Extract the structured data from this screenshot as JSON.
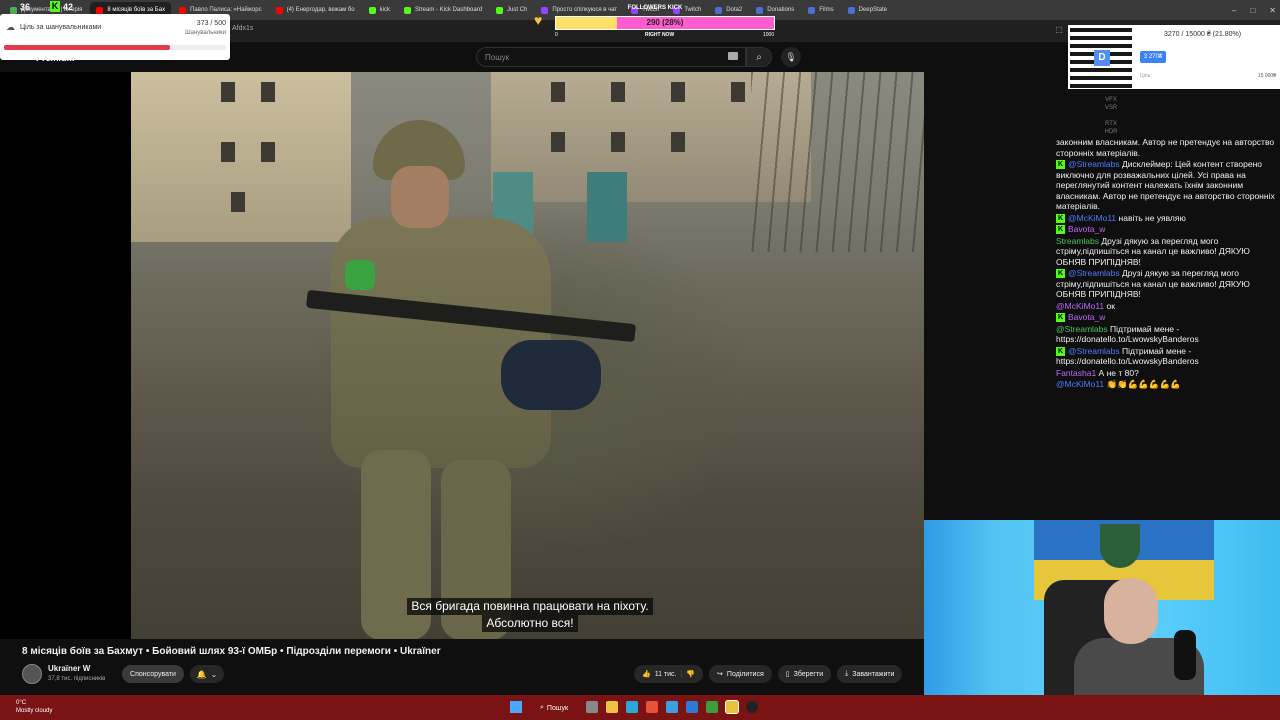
{
  "browser": {
    "tabs": [
      {
        "label": "Документація | Історія",
        "color": "#4caf50"
      },
      {
        "label": "8 місяців боїв за Бах",
        "color": "#ff0000",
        "active": true
      },
      {
        "label": "Павло Палиса: «Найжорс",
        "color": "#ff0000"
      },
      {
        "label": "(4) Енергодар, вежам бо",
        "color": "#ff0000"
      },
      {
        "label": "kick",
        "color": "#53fc18"
      },
      {
        "label": "Stream - Kick Dashboard",
        "color": "#53fc18"
      },
      {
        "label": "Just Ch",
        "color": "#53fc18"
      },
      {
        "label": "Просто спілкуюся в чат",
        "color": "#9146ff"
      },
      {
        "label": "Twitch",
        "color": "#9146ff"
      },
      {
        "label": "Twitch",
        "color": "#9146ff"
      },
      {
        "label": "Dota2",
        "color": "#4a6fd1"
      },
      {
        "label": "Donations",
        "color": "#4a6fd1"
      },
      {
        "label": "Films",
        "color": "#4a6fd1"
      },
      {
        "label": "DeepState",
        "color": "#4a6fd1"
      }
    ],
    "window_controls": [
      "–",
      "□",
      "✕"
    ],
    "url_fragment": "Afdx1s"
  },
  "youtube": {
    "premium_label": "Premium",
    "search_placeholder": "Пошук",
    "video_title": "8 місяців боїв за Бахмут • Бойовий шлях 93-ї ОМБр • Підрозділи перемоги • Ukraїner",
    "channel_name": "Ukraїner W",
    "channel_subs": "37,8 тис. підписників",
    "sponsor_label": "Спонсорувати",
    "likes": "11 тис.",
    "share_label": "Поділитися",
    "save_label": "Зберегти",
    "download_label": "Завантажити",
    "subtitle_line1": "Вся бригада повинна працювати на піхоту.",
    "subtitle_line2": "Абсолютно вся!",
    "player_menu": [
      "VFX",
      "VSR",
      "RTX",
      "HDR"
    ]
  },
  "overlay_goal": {
    "stream_num": "36",
    "kick_num": "42",
    "title": "Ціль за шанувальниками",
    "count": "373 / 500",
    "sub": "Шанувальники",
    "progress": 0.746
  },
  "overlay_followers": {
    "title": "FOLLOWERS KICK",
    "value_text": "290 (28%)",
    "progress": 0.28,
    "min": "0",
    "now_label": "RIGHT NOW",
    "max": "1000"
  },
  "overlay_donate": {
    "progress_text": "3270 / 15000 ₴ (21.80%)",
    "badge": "3 270₴",
    "label": "Ціль:",
    "max": "15 000₴"
  },
  "chat": {
    "messages": [
      {
        "user": "",
        "text": "законним власникам. Автор не претендує на авторство сторонніх матеріалів.",
        "platform": ""
      },
      {
        "user": "@Streamlabs",
        "text": "Дисклеймер: Цей контент створено виключно для розважальних цілей. Усі права на переглянутий контент належать їхнім законним власникам. Автор не претендує на авторство сторонніх матеріалів.",
        "platform": "K",
        "ucls": "blue"
      },
      {
        "user": "@McKiMo11",
        "text": "навіть не уявляю",
        "platform": "K",
        "ucls": "blue"
      },
      {
        "user": "Bavota_w",
        "text": "",
        "platform": "K",
        "ucls": "pink"
      },
      {
        "user": "Streamlabs",
        "text": "Друзі дякую за перегляд мого стріму,підпишіться на канал це важливо! ДЯКУЮ ОБНЯВ ПРИПІДНЯВ!",
        "platform": "",
        "ucls": "green"
      },
      {
        "user": "@Streamlabs",
        "text": "Друзі дякую за перегляд мого стріму,підпишіться на канал це важливо! ДЯКУЮ ОБНЯВ ПРИПІДНЯВ!",
        "platform": "K",
        "ucls": "blue"
      },
      {
        "user": "@McKiMo11",
        "text": "ок",
        "platform": "",
        "ucls": "pink"
      },
      {
        "user": "Bavota_w",
        "text": "",
        "platform": "K",
        "ucls": "pink"
      },
      {
        "user": "@Streamlabs",
        "text": "Підтримай мене - https://donatello.to/LwowskyBanderos",
        "platform": "",
        "ucls": "green"
      },
      {
        "user": "@Streamlabs",
        "text": "Підтримай мене - https://donatello.to/LwowskyBanderos",
        "platform": "K",
        "ucls": "blue"
      },
      {
        "user": "Fantasha1",
        "text": "А не т 80?",
        "platform": "",
        "ucls": "pink"
      },
      {
        "user": "@McKiMo11",
        "text": "👏👏💪💪💪💪💪",
        "platform": "",
        "ucls": "blue"
      }
    ]
  },
  "taskbar": {
    "weather_temp": "0°C",
    "weather_desc": "Mostly cloudy",
    "search_label": "Пошук"
  }
}
